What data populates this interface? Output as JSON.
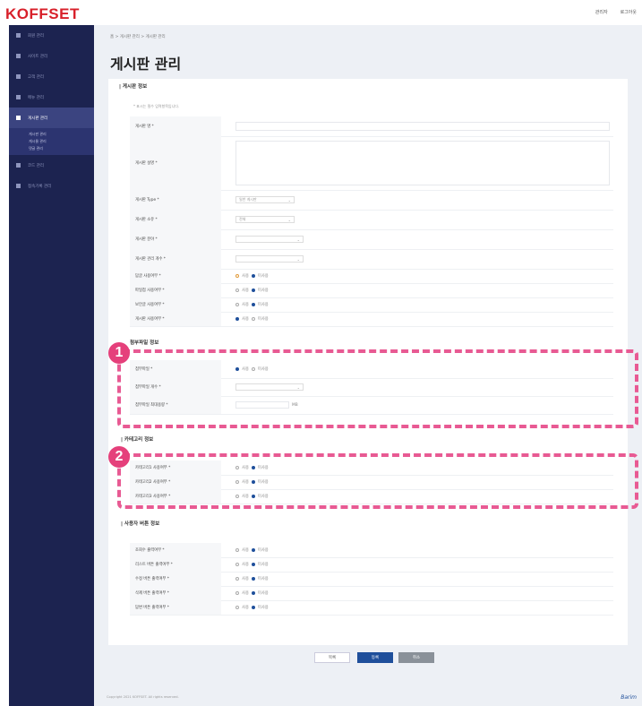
{
  "header": {
    "logo": "KOFFSET",
    "user_label": "관리자",
    "logout_label": "로그아웃"
  },
  "sidebar": {
    "items": [
      {
        "label": "회원 관리"
      },
      {
        "label": "사이트 관리"
      },
      {
        "label": "고객 관리"
      },
      {
        "label": "메뉴 관리"
      },
      {
        "label": "게시판 관리",
        "active": true
      },
      {
        "label": "코드 관리"
      },
      {
        "label": "접속기록 관리"
      }
    ],
    "subitems": [
      "게시판 관리",
      "게시물 관리",
      "댓글 관리"
    ]
  },
  "breadcrumb": "홈 > 게시판 관리 > 게시판 관리",
  "page_title": "게시판 관리",
  "sections": {
    "board_info": {
      "title": "| 게시판 정보",
      "note": "* 표시는 필수 입력항목입니다.",
      "rows": [
        {
          "label": "게시판 명 *",
          "type": "input"
        },
        {
          "label": "게시판 설명 *",
          "type": "textarea"
        },
        {
          "label": "게시판 Type *",
          "type": "select",
          "value": "일반 게시판"
        },
        {
          "label": "게시판 소유 *",
          "type": "select",
          "value": "전체"
        },
        {
          "label": "게시판 분야 *",
          "type": "select",
          "value": ""
        },
        {
          "label": "게시판 관리 개수 *",
          "type": "select",
          "value": ""
        },
        {
          "label": "답글 사용여부 *",
          "type": "radio",
          "options": [
            "사용",
            "미사용"
          ],
          "selected": 1
        },
        {
          "label": "파일첨 사용여부 *",
          "type": "radio",
          "options": [
            "사용",
            "미사용"
          ],
          "selected": 1
        },
        {
          "label": "보안글 사용여부 *",
          "type": "radio",
          "options": [
            "사용",
            "미사용"
          ],
          "selected": 1
        },
        {
          "label": "게시판 사용여부 *",
          "type": "radio",
          "options": [
            "사용",
            "미사용"
          ],
          "selected": 0
        }
      ]
    },
    "attach_info": {
      "title": "첨부파일 정보",
      "badge": "1",
      "rows": [
        {
          "label": "첨부파일 *",
          "type": "radio",
          "options": [
            "사용",
            "미사용"
          ],
          "selected": 0
        },
        {
          "label": "첨부파일 개수 *",
          "type": "select",
          "value": ""
        },
        {
          "label": "첨부파일 최대용량 *",
          "type": "text",
          "value": "MB"
        }
      ]
    },
    "category_info": {
      "title": "| 카테고리 정보",
      "badge": "2",
      "rows": [
        {
          "label": "카테고리1 사용여부 *",
          "options": [
            "사용",
            "미사용"
          ],
          "selected": 1
        },
        {
          "label": "카테고리2 사용여부 *",
          "options": [
            "사용",
            "미사용"
          ],
          "selected": 1
        },
        {
          "label": "카테고리3 사용여부 *",
          "options": [
            "사용",
            "미사용"
          ],
          "selected": 1
        }
      ]
    },
    "user_button_info": {
      "title": "| 사용자 버튼 정보",
      "rows": [
        {
          "label": "조회수 출력여부 *",
          "options": [
            "사용",
            "미사용"
          ],
          "selected": 1
        },
        {
          "label": "리스트 버튼 출력여부 *",
          "options": [
            "사용",
            "미사용"
          ],
          "selected": 1
        },
        {
          "label": "수정 버튼 출력여부 *",
          "options": [
            "사용",
            "미사용"
          ],
          "selected": 1
        },
        {
          "label": "삭제 버튼 출력여부 *",
          "options": [
            "사용",
            "미사용"
          ],
          "selected": 1
        },
        {
          "label": "답변 버튼 출력여부 *",
          "options": [
            "사용",
            "미사용"
          ],
          "selected": 1
        }
      ]
    }
  },
  "buttons": {
    "list": "목록",
    "save": "등록",
    "cancel": "취소"
  },
  "footer": {
    "copyright": "Copyright 2021 KOFFSET. All rights reserved.",
    "logo": "Barim"
  },
  "colors": {
    "sidebar": "#1c2350",
    "accent": "#1f4f9b",
    "highlight": "#e85a93",
    "brand": "#d8202a"
  }
}
